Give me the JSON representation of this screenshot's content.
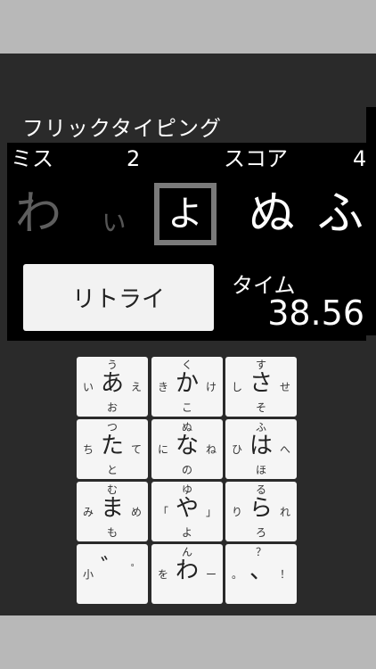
{
  "app": {
    "title": "フリックタイピング"
  },
  "stats": {
    "miss_label": "ミス",
    "miss_value": "2",
    "score_label": "スコア",
    "score_value": "4"
  },
  "sequence": {
    "prev2": "わ",
    "prev1": "ぃ",
    "current": "よ",
    "next1": "ぬ",
    "next2": "ふ"
  },
  "retry_label": "リトライ",
  "timer": {
    "label": "タイム",
    "value": "38.56"
  },
  "keypad": {
    "keys": [
      {
        "center": "あ",
        "up": "う",
        "left": "い",
        "right": "え",
        "down": "お"
      },
      {
        "center": "か",
        "up": "く",
        "left": "き",
        "right": "け",
        "down": "こ"
      },
      {
        "center": "さ",
        "up": "す",
        "left": "し",
        "right": "せ",
        "down": "そ"
      },
      {
        "center": "た",
        "up": "つ",
        "left": "ち",
        "right": "て",
        "down": "と"
      },
      {
        "center": "な",
        "up": "ぬ",
        "left": "に",
        "right": "ね",
        "down": "の"
      },
      {
        "center": "は",
        "up": "ふ",
        "left": "ひ",
        "right": "へ",
        "down": "ほ"
      },
      {
        "center": "ま",
        "up": "む",
        "left": "み",
        "right": "め",
        "down": "も"
      },
      {
        "center": "や",
        "up": "ゆ",
        "left": "「",
        "right": "」",
        "down": "よ"
      },
      {
        "center": "ら",
        "up": "る",
        "left": "り",
        "right": "れ",
        "down": "ろ"
      },
      {
        "center": "゛",
        "up": "",
        "left": "小",
        "right": "゜",
        "down": ""
      },
      {
        "center": "わ",
        "up": "ん",
        "left": "を",
        "right": "ー",
        "down": ""
      },
      {
        "center": "、",
        "up": "？",
        "left": "。",
        "right": "！",
        "down": ""
      }
    ]
  }
}
